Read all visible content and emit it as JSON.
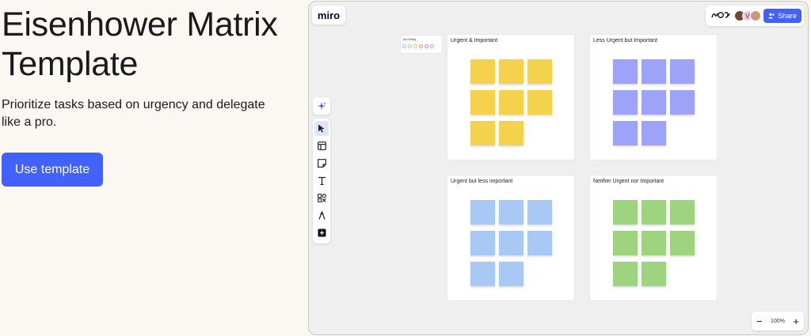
{
  "hero": {
    "title": "Eisenhower Matrix Template",
    "subtitle": "Prioritize tasks based on urgency and delegate like a pro.",
    "cta_label": "Use template"
  },
  "board": {
    "logo": "miro",
    "reactions": "ꟷ0ꟷ",
    "avatars": [
      {
        "initial": "",
        "color": "#6b4a3a"
      },
      {
        "initial": "V",
        "color": "#f3c6dc"
      },
      {
        "initial": "",
        "color": "#c99a7a"
      }
    ],
    "share_label": "Share",
    "mini_legend": {
      "title": "Dot Voting",
      "dot_colors": [
        "#9fd1c5",
        "#9fd1c5",
        "#f2c94c",
        "#f28b82",
        "#c58af9",
        "#8ab4f8"
      ]
    },
    "quadrants": [
      {
        "title": "Urgent & Important",
        "note_color": "#f4d24d",
        "count": 8
      },
      {
        "title": "Less Urgent but Important",
        "note_color": "#9ea3fa",
        "count": 8
      },
      {
        "title": "Urgent but less important",
        "note_color": "#a9c9f5",
        "count": 8
      },
      {
        "title": "Neither Urgent nor Important",
        "note_color": "#9ed37f",
        "count": 8
      }
    ],
    "zoom": {
      "level": "100%",
      "minus": "−",
      "plus": "+"
    },
    "tools": [
      "magic-icon",
      "select-icon",
      "template-icon",
      "sticky-note-icon",
      "text-icon",
      "shapes-icon",
      "pen-icon",
      "add-icon"
    ]
  },
  "colors": {
    "accent": "#4262ff",
    "background": "#fbf8f4",
    "board": "#efefef"
  }
}
